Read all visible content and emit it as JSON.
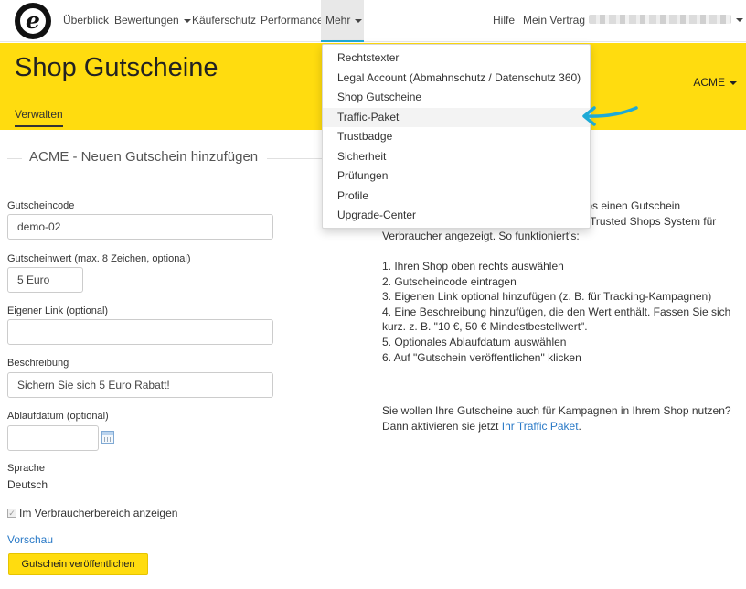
{
  "nav": {
    "logo_letter": "e",
    "items": [
      "Überblick",
      "Bewertungen",
      "Käuferschutz",
      "Performance",
      "Mehr"
    ],
    "right_items": [
      "Hilfe",
      "Mein Vertrag"
    ]
  },
  "header": {
    "title": "Shop Gutscheine",
    "tab": "Verwalten",
    "shop": "ACME"
  },
  "form": {
    "section_title": "ACME - Neuen Gutschein hinzufügen",
    "code_label": "Gutscheincode",
    "code_value": "demo-02",
    "value_label": "Gutscheinwert (max. 8 Zeichen, optional)",
    "value_value": "5 Euro",
    "link_label": "Eigener Link (optional)",
    "link_value": "",
    "desc_label": "Beschreibung",
    "desc_value": "Sichern Sie sich 5 Euro Rabatt!",
    "expiry_label": "Ablaufdatum (optional)",
    "expiry_value": "",
    "language_label": "Sprache",
    "language_value": "Deutsch",
    "show_label": "Im Verbraucherbereich anzeigen",
    "show_checked": true,
    "preview_link": "Vorschau",
    "publish_button": "Gutschein veröffentlichen"
  },
  "help": {
    "line1": "tenlos einen Gutschein",
    "line2": "Trusted Shops System für",
    "line3": "Verbraucher angezeigt. So funktioniert's:",
    "steps": [
      "1. Ihren Shop oben rechts auswählen",
      "2. Gutscheincode eintragen",
      "3. Eigenen Link optional hinzufügen (z. B. für Tracking-Kampagnen)",
      "4. Eine Beschreibung hinzufügen, die den Wert enthält. Fassen Sie sich",
      "kurz. z. B. \"10 €, 50 € Mindestbestellwert\".",
      "5. Optionales Ablaufdatum auswählen",
      "6. Auf \"Gutschein veröffentlichen\" klicken"
    ],
    "campaign_line1": "Sie wollen Ihre Gutscheine auch für Kampagnen in Ihrem Shop nutzen?",
    "campaign_line2_prefix": "Dann aktivieren sie jetzt ",
    "campaign_link": "Ihr Traffic Paket",
    "campaign_line2_suffix": "."
  },
  "dropdown": {
    "items": [
      "Rechtstexter",
      "Legal Account (Abmahnschutz / Datenschutz 360)",
      "Shop Gutscheine",
      "Traffic-Paket",
      "Trustbadge",
      "Sicherheit",
      "Prüfungen",
      "Profile",
      "Upgrade-Center"
    ],
    "highlighted": "Traffic-Paket"
  },
  "colors": {
    "brand_yellow": "#ffdc0f",
    "link_blue": "#2a7ac7",
    "active_underline": "#1fa9d6",
    "arrow": "#1eaad6"
  }
}
